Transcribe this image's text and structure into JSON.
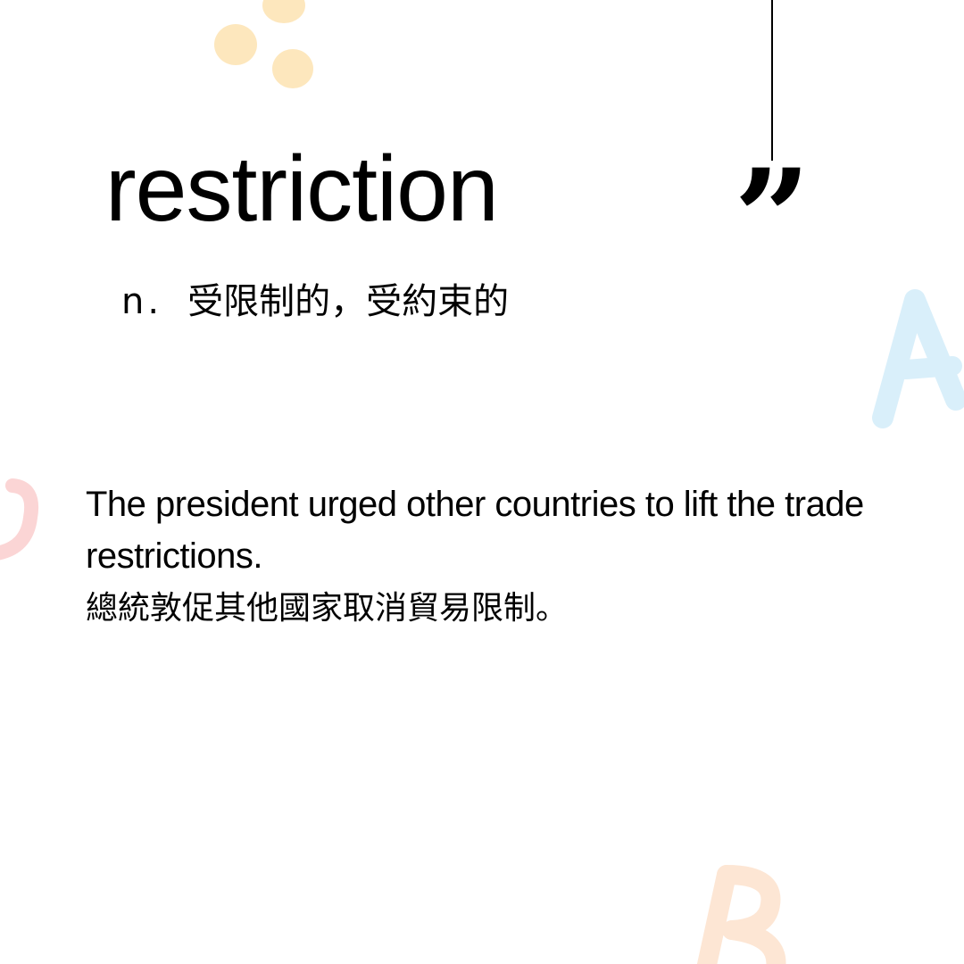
{
  "card": {
    "word": "restriction",
    "part_of_speech": "n.",
    "definition_zh": "受限制的，受約束的",
    "example_en": "The president urged other countries to lift the trade restrictions.",
    "example_zh": "總統敦促其他國家取消貿易限制。"
  },
  "decorations": {
    "quote_glyph": "”",
    "letter_a": "A",
    "letter_b": "B",
    "letter_c": "C"
  },
  "colors": {
    "background": "#ffffff",
    "text": "#000000",
    "dot_yellow": "#fde7bd",
    "letter_a_blue": "#d9effa",
    "letter_b_orange": "#fde6d4",
    "letter_c_pink": "#fbd5d5"
  }
}
